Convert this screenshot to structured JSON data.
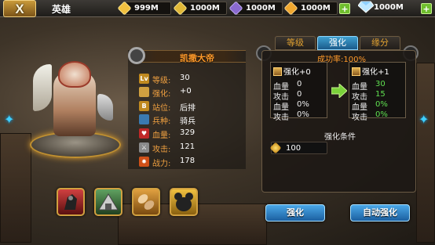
{
  "header": {
    "title": "英雄",
    "resources": [
      {
        "icon": "gold-coin-icon",
        "value": "999M",
        "color": "#f0c040"
      },
      {
        "icon": "yellow-crystal-icon",
        "value": "1000M",
        "color": "#e0b838"
      },
      {
        "icon": "purple-crystal-icon",
        "value": "1000M",
        "color": "#8a6ad0"
      },
      {
        "icon": "orange-crystal-icon",
        "value": "1000M",
        "color": "#f0a830"
      }
    ],
    "plus_label": "+"
  },
  "hero": {
    "name": "凯撒大帝",
    "stats": [
      {
        "icon": "level-icon",
        "icon_text": "Lv",
        "label": "等级:",
        "value": "30",
        "color": "#c08a20"
      },
      {
        "icon": "enhance-icon",
        "icon_text": "",
        "label": "强化:",
        "value": "+0",
        "color": "#d0a040"
      },
      {
        "icon": "position-icon",
        "icon_text": "B",
        "label": "站位:",
        "value": "后排",
        "color": "#c08a20"
      },
      {
        "icon": "troop-icon",
        "icon_text": "",
        "label": "兵种:",
        "value": "骑兵",
        "color": "#3a7ab0"
      },
      {
        "icon": "heart-icon",
        "icon_text": "♥",
        "label": "血量:",
        "value": "329",
        "color": "#c02828"
      },
      {
        "icon": "attack-icon",
        "icon_text": "⚔",
        "label": "攻击:",
        "value": "121",
        "color": "#8a8a8a"
      },
      {
        "icon": "power-icon",
        "icon_text": "🔥",
        "label": "战力:",
        "value": "178",
        "color": "#d05018"
      }
    ]
  },
  "tabs": [
    {
      "label": "等级",
      "active": false
    },
    {
      "label": "强化",
      "active": true
    },
    {
      "label": "缘分",
      "active": false
    }
  ],
  "enhance": {
    "success_rate": "成功率:100%",
    "current": {
      "title": "强化+0",
      "rows": [
        {
          "label": "血量",
          "value": "0"
        },
        {
          "label": "攻击",
          "value": "0"
        },
        {
          "label": "血量",
          "value": "0%"
        },
        {
          "label": "攻击",
          "value": "0%"
        }
      ]
    },
    "next": {
      "title": "强化+1",
      "rows": [
        {
          "label": "血量",
          "value": "30"
        },
        {
          "label": "攻击",
          "value": "15"
        },
        {
          "label": "血量",
          "value": "0%"
        },
        {
          "label": "攻击",
          "value": "0%"
        }
      ]
    },
    "requirement_title": "强化条件",
    "requirement_value": "100"
  },
  "buttons": {
    "enhance": "强化",
    "auto_enhance": "自动强化"
  }
}
